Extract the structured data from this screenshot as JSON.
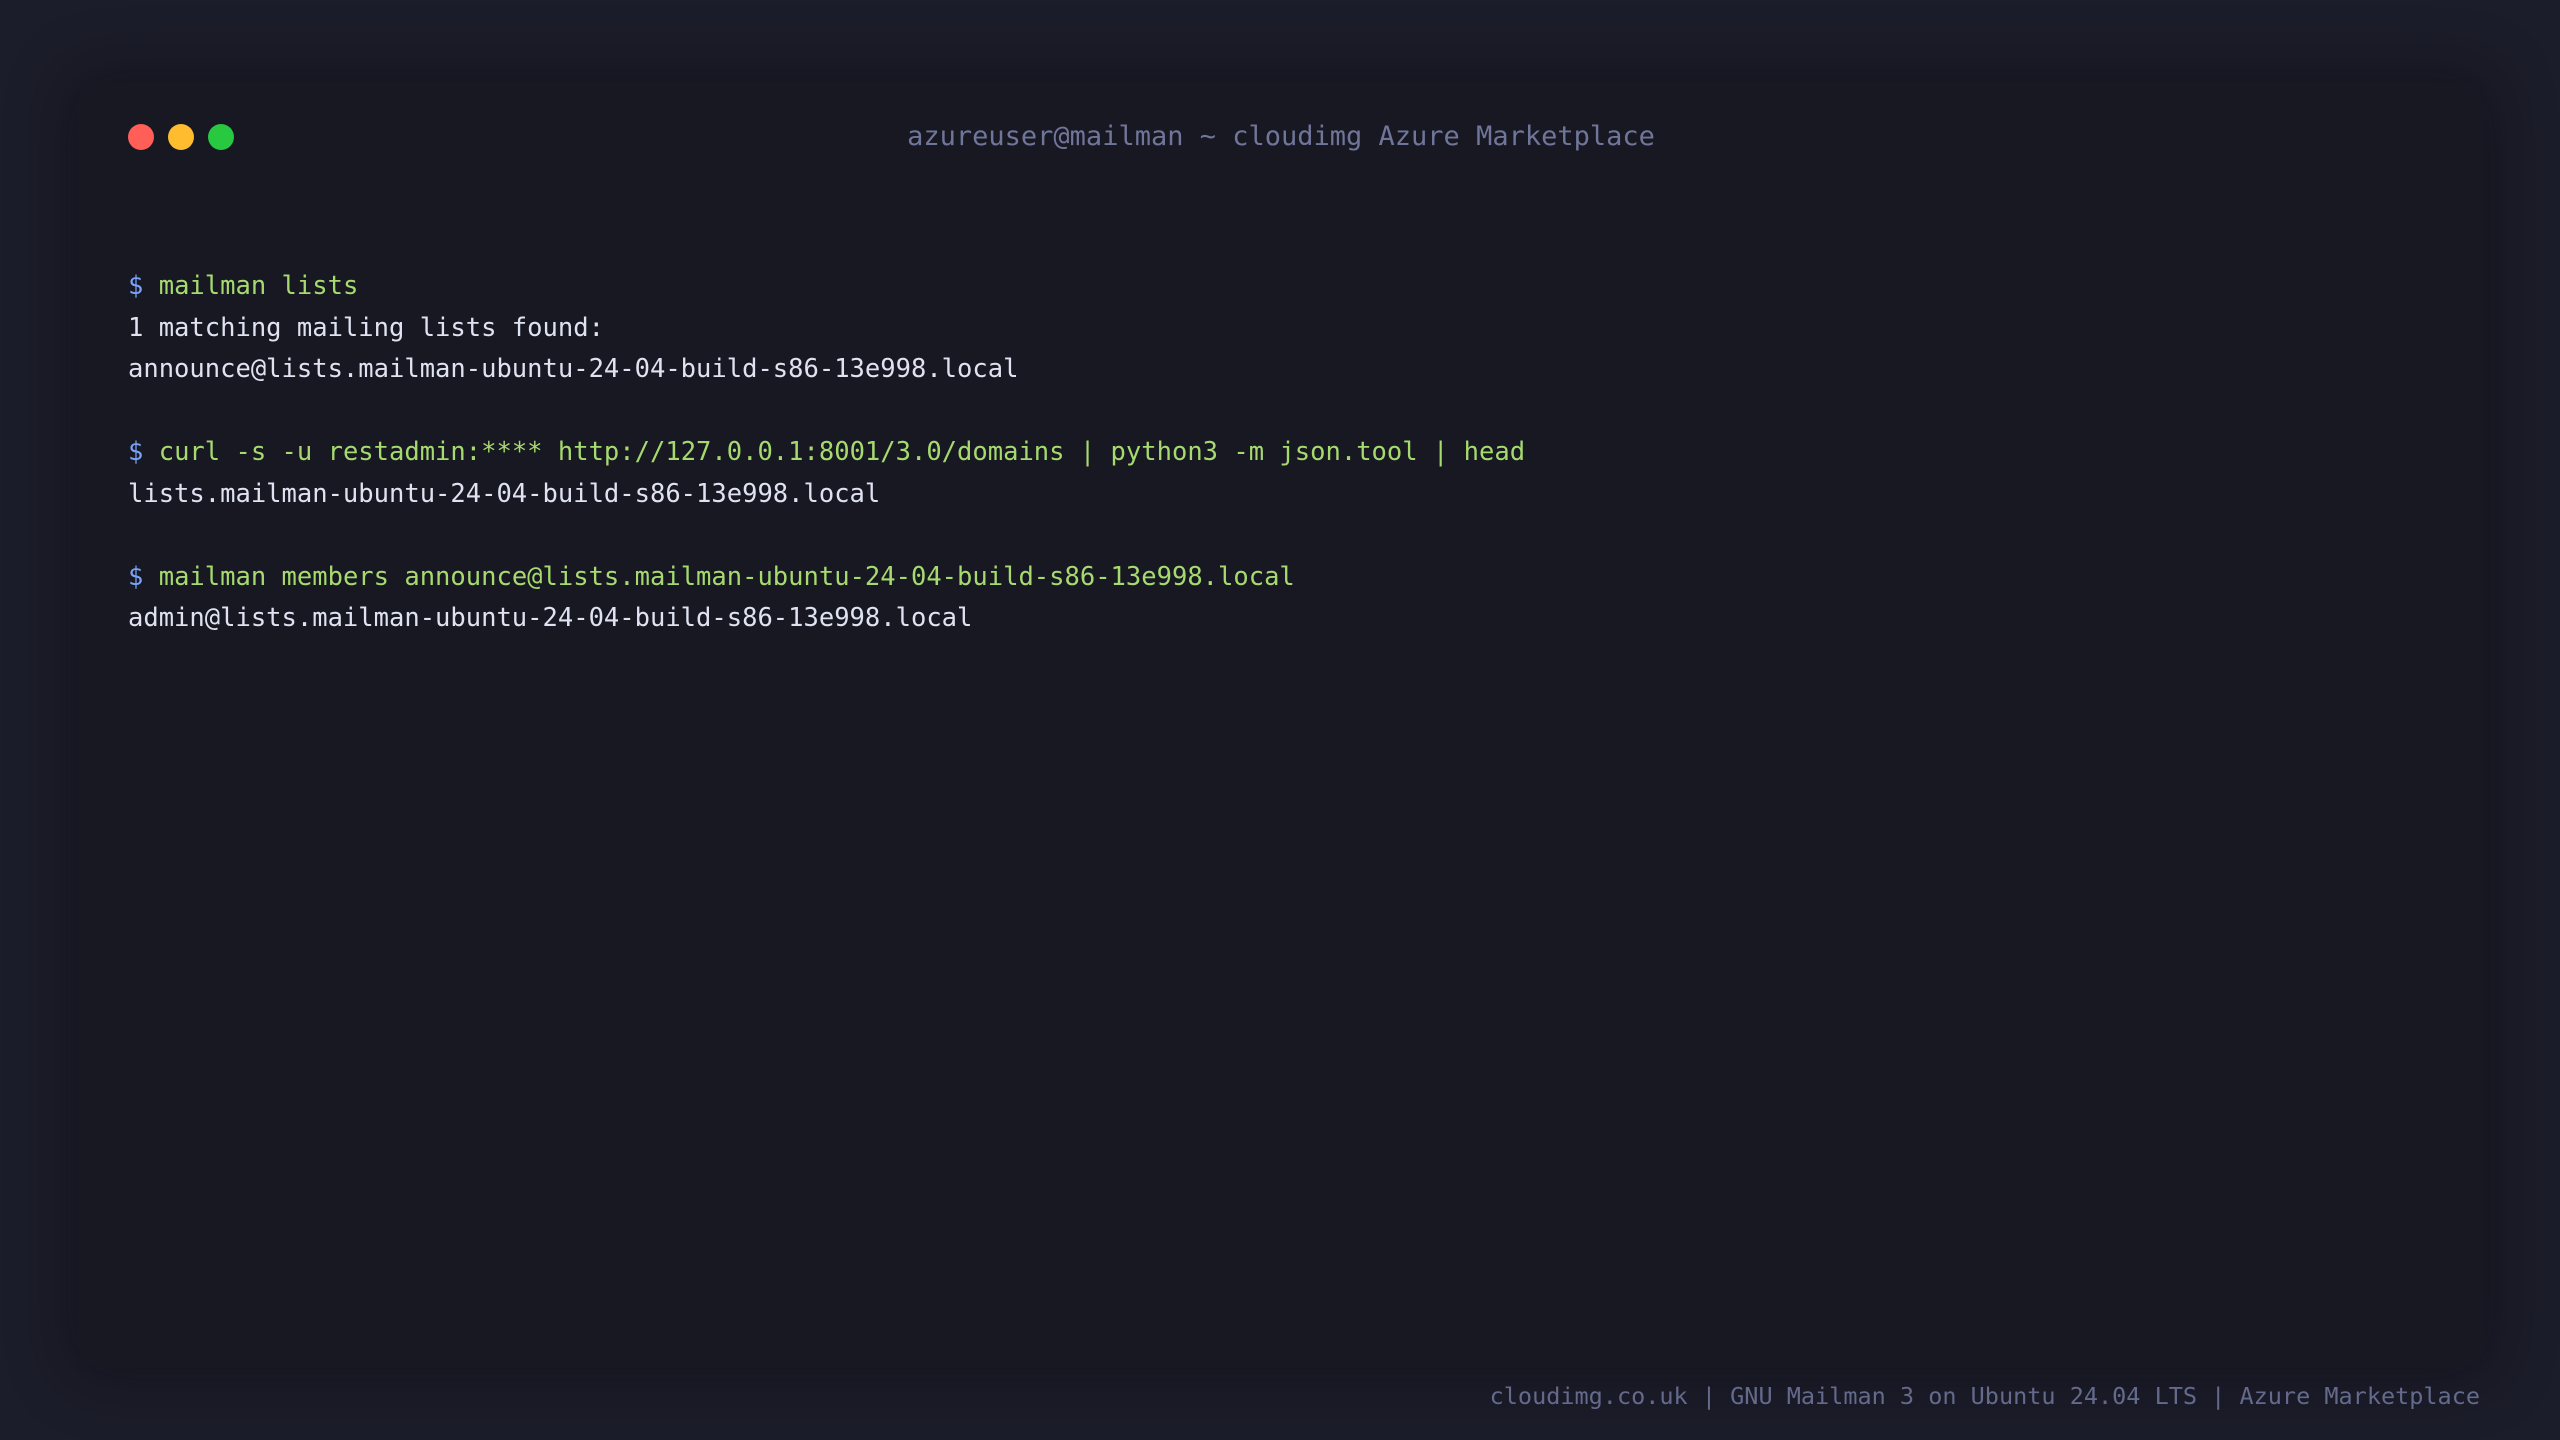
{
  "window": {
    "title": "azureuser@mailman ~ cloudimg Azure Marketplace",
    "buttons": [
      {
        "name": "close",
        "color": "#ff5f57"
      },
      {
        "name": "minimize",
        "color": "#febc2e"
      },
      {
        "name": "maximize",
        "color": "#28c840"
      }
    ]
  },
  "colors": {
    "prompt": "#7aa2f7",
    "command": "#a6da6f",
    "output": "#dfe2f1",
    "title": "#70759a",
    "footer": "#646a8c"
  },
  "terminal": {
    "prompt_symbol": "$",
    "blocks": [
      {
        "command": "mailman lists",
        "output": [
          "1 matching mailing lists found:",
          "announce@lists.mailman-ubuntu-24-04-build-s86-13e998.local"
        ]
      },
      {
        "command": "curl -s -u restadmin:**** http://127.0.0.1:8001/3.0/domains | python3 -m json.tool | head",
        "output": [
          "lists.mailman-ubuntu-24-04-build-s86-13e998.local"
        ]
      },
      {
        "command": "mailman members announce@lists.mailman-ubuntu-24-04-build-s86-13e998.local",
        "output": [
          "admin@lists.mailman-ubuntu-24-04-build-s86-13e998.local"
        ]
      }
    ]
  },
  "footer": {
    "text": "cloudimg.co.uk | GNU Mailman 3 on Ubuntu 24.04 LTS | Azure Marketplace"
  }
}
